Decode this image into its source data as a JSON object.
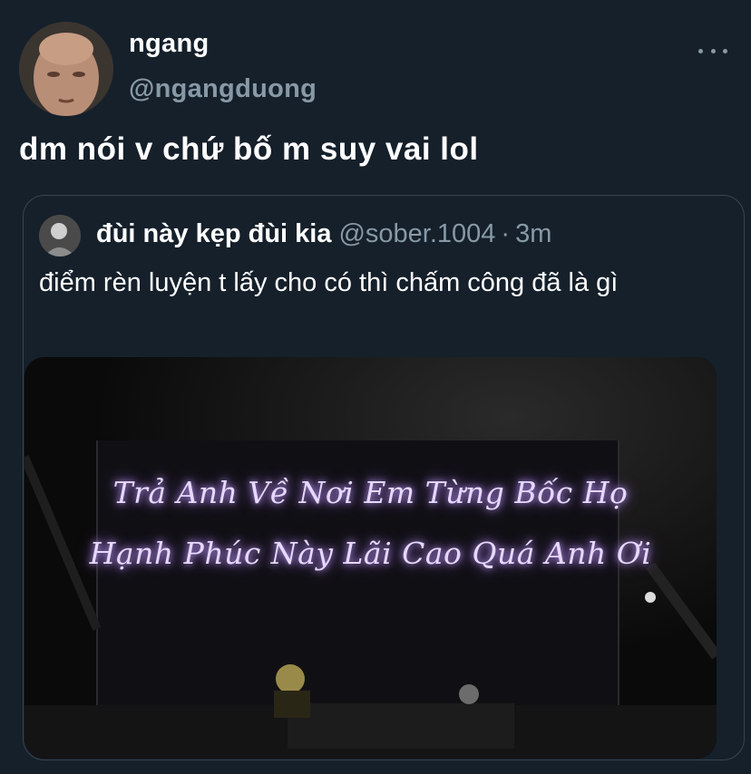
{
  "tweet": {
    "display_name": "ngang",
    "handle": "@ngangduong",
    "text": "dm nói v chứ bố m suy vai lol",
    "more_icon": "more-horizontal-icon"
  },
  "quoted": {
    "display_name": "đùi này kẹp đùi kia",
    "handle": "@sober.1004",
    "separator": "·",
    "time": "3m",
    "text": "điểm rèn luyện t lấy cho có thì chấm công đã là gì",
    "media": {
      "line1": "Trả Anh Về Nơi Em Từng Bốc Họ",
      "line2": "Hạnh Phúc Này Lãi Cao Quá Anh Ơi"
    }
  },
  "colors": {
    "background": "#15202b",
    "secondary_text": "#8899a6",
    "border": "#38444d",
    "caption_glow": "#c9a5ff"
  }
}
